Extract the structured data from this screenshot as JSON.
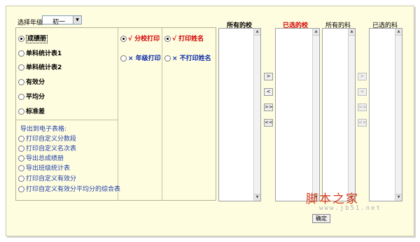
{
  "grade": {
    "label": "选择年级",
    "value": "初一"
  },
  "report_types": [
    {
      "label": "成绩册",
      "selected": true
    },
    {
      "label": "单科统计表1",
      "selected": false
    },
    {
      "label": "单科统计表2",
      "selected": false
    },
    {
      "label": "有效分",
      "selected": false
    },
    {
      "label": "平均分",
      "selected": false
    },
    {
      "label": "标准差",
      "selected": false
    }
  ],
  "export": {
    "title": "导出到电子表格:",
    "items": [
      "打印自定义分数段",
      "打印自定义名次表",
      "导出总成绩册",
      "导出班级统计表",
      "打印自定义有效分",
      "打印自定义有效分平均分的综合表"
    ]
  },
  "print_scope": [
    {
      "label": "√ 分校打印",
      "selected": true
    },
    {
      "label": "× 年级打印",
      "selected": false
    }
  ],
  "name_print": [
    {
      "label": "√ 打印姓名",
      "selected": true
    },
    {
      "label": "× 不打印姓名",
      "selected": false
    }
  ],
  "lists": {
    "all_schools": "所有的校",
    "selected_schools": "已选的校",
    "all_subjects": "所有的科",
    "selected_subjects": "已选的科"
  },
  "move_buttons": [
    ">",
    "<",
    ">>",
    "<<"
  ],
  "ok_label": "确定",
  "watermark": {
    "main": "脚本之家",
    "url": "www.jb51.net"
  },
  "colors": {
    "panel_bg": "#fffde0",
    "red": "#d00000",
    "blue": "#0a2aa8"
  }
}
